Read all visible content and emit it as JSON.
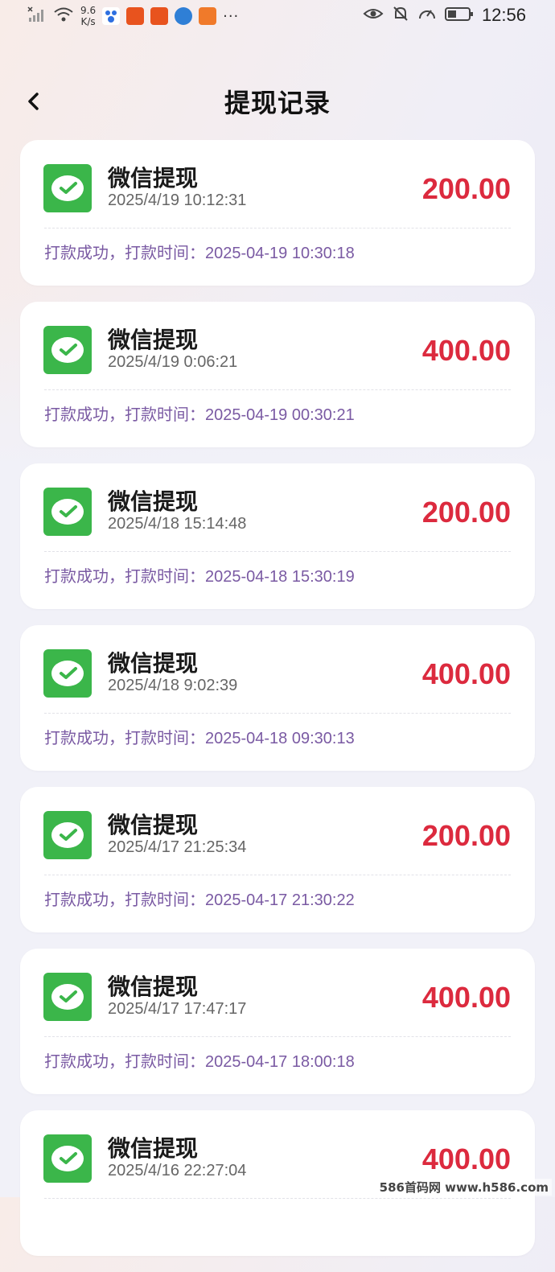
{
  "status_bar": {
    "net_speed_value": "9.6",
    "net_speed_unit": "K/s",
    "more": "···",
    "clock": "12:56"
  },
  "header": {
    "title": "提现记录"
  },
  "records": [
    {
      "title": "微信提现",
      "time": "2025/4/19 10:12:31",
      "amount": "200.00",
      "status": "打款成功，打款时间：",
      "pay_time": "2025-04-19 10:30:18"
    },
    {
      "title": "微信提现",
      "time": "2025/4/19 0:06:21",
      "amount": "400.00",
      "status": "打款成功，打款时间：",
      "pay_time": "2025-04-19 00:30:21"
    },
    {
      "title": "微信提现",
      "time": "2025/4/18 15:14:48",
      "amount": "200.00",
      "status": "打款成功，打款时间：",
      "pay_time": "2025-04-18 15:30:19"
    },
    {
      "title": "微信提现",
      "time": "2025/4/18 9:02:39",
      "amount": "400.00",
      "status": "打款成功，打款时间：",
      "pay_time": "2025-04-18 09:30:13"
    },
    {
      "title": "微信提现",
      "time": "2025/4/17 21:25:34",
      "amount": "200.00",
      "status": "打款成功，打款时间：",
      "pay_time": "2025-04-17 21:30:22"
    },
    {
      "title": "微信提现",
      "time": "2025/4/17 17:47:17",
      "amount": "400.00",
      "status": "打款成功，打款时间：",
      "pay_time": "2025-04-17 18:00:18"
    },
    {
      "title": "微信提现",
      "time": "2025/4/16 22:27:04",
      "amount": "400.00",
      "status": "",
      "pay_time": ""
    }
  ],
  "watermark": "586首码网 www.h586.com",
  "colors": {
    "amount": "#dc2a3e",
    "status_text": "#7a5aa3",
    "wechat_green": "#3bb64a"
  }
}
